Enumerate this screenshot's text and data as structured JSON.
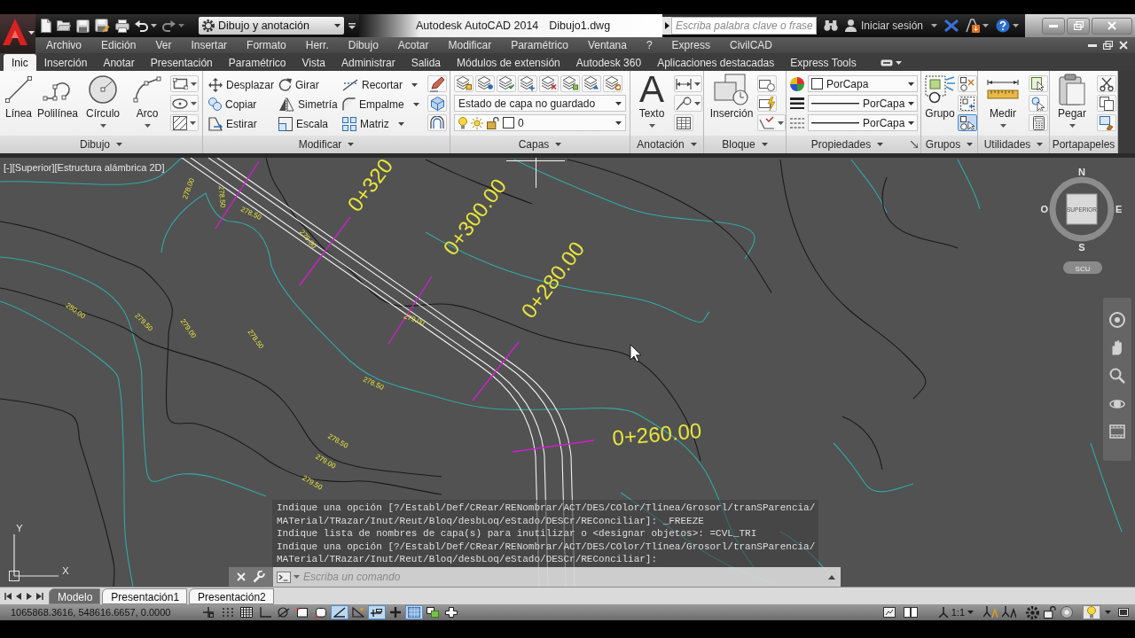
{
  "title_bar": {
    "workspace": "Dibujo y anotación",
    "app_title": "Autodesk AutoCAD 2014",
    "file_name": "Dibujo1.dwg",
    "search": {
      "placeholder": "Escriba palabra clave o frase"
    },
    "sign_in": "Iniciar sesión"
  },
  "menu_bar": [
    "Archivo",
    "Edición",
    "Ver",
    "Insertar",
    "Formato",
    "Herr.",
    "Dibujo",
    "Acotar",
    "Modificar",
    "Paramétrico",
    "Ventana",
    "?",
    "Express",
    "CivilCAD"
  ],
  "ribbon_tabs": [
    {
      "label": "Inic",
      "selected": true
    },
    {
      "label": "Inserción",
      "selected": false
    },
    {
      "label": "Anotar",
      "selected": false
    },
    {
      "label": "Presentación",
      "selected": false
    },
    {
      "label": "Paramétrico",
      "selected": false
    },
    {
      "label": "Vista",
      "selected": false
    },
    {
      "label": "Administrar",
      "selected": false
    },
    {
      "label": "Salida",
      "selected": false
    },
    {
      "label": "Módulos de extensión",
      "selected": false
    },
    {
      "label": "Autodesk 360",
      "selected": false
    },
    {
      "label": "Aplicaciones destacadas",
      "selected": false
    },
    {
      "label": "Express Tools",
      "selected": false
    }
  ],
  "ribbon_panels": [
    {
      "kind": "draw",
      "title": "Dibujo",
      "menu": true,
      "buttons": [
        {
          "label": "Línea",
          "menu": false
        },
        {
          "label": "Polilínea",
          "menu": false
        },
        {
          "label": "Círculo",
          "menu": true
        },
        {
          "label": "Arco",
          "menu": true
        }
      ]
    },
    {
      "kind": "modify",
      "title": "Modificar",
      "menu": true,
      "buttons": [
        {
          "label": "Desplazar",
          "menu": false
        },
        {
          "label": "Girar",
          "menu": false
        },
        {
          "label": "Recortar",
          "menu": true
        },
        {
          "label": "Copiar",
          "menu": false
        },
        {
          "label": "Simetría",
          "menu": false
        },
        {
          "label": "Empalme",
          "menu": true
        },
        {
          "label": "Estirar",
          "menu": false
        },
        {
          "label": "Escala",
          "menu": false
        },
        {
          "label": "Matriz",
          "menu": true
        }
      ]
    },
    {
      "kind": "layers",
      "title": "Capas",
      "menu": true,
      "layer_state": "Estado de capa no guardado",
      "current_layer": "0"
    },
    {
      "kind": "annotation",
      "title": "Anotación",
      "menu": true,
      "glyph": "A",
      "buttons": [
        {
          "label": "Texto",
          "menu": true
        }
      ]
    },
    {
      "kind": "block",
      "title": "Bloque",
      "menu": true,
      "buttons": [
        {
          "label": "Inserción",
          "menu": false
        }
      ]
    },
    {
      "kind": "properties",
      "title": "Propiedades",
      "menu": true,
      "values": [
        "PorCapa",
        "PorCapa",
        "PorCapa"
      ]
    },
    {
      "kind": "groups",
      "title": "Grupos",
      "menu": true,
      "buttons": [
        {
          "label": "Grupo",
          "menu": false
        }
      ],
      "small_buttons": [
        {
          "on": false
        },
        {
          "on": false
        },
        {
          "on": true
        }
      ]
    },
    {
      "kind": "utilities",
      "title": "Utilidades",
      "menu": true,
      "buttons": [
        {
          "label": "Medir",
          "menu": true
        }
      ]
    },
    {
      "kind": "clipboard",
      "title": "Portapapeles",
      "menu": false,
      "buttons": [
        {
          "label": "Pegar",
          "menu": true
        }
      ]
    }
  ],
  "viewport": {
    "controls": [
      "[-]",
      "[Superior]",
      "[Estructura alámbrica 2D]"
    ],
    "station_labels": [
      "0+320",
      "0+300.00",
      "0+280.00",
      "0+260.00"
    ],
    "contour_labels": [
      "278.00",
      "278.50",
      "278.50",
      "279.00",
      "280.00",
      "279.50",
      "279.00",
      "278.50",
      "279.00",
      "278.50",
      "278.50",
      "279.00",
      "279.50"
    ],
    "viewcube": {
      "face": "SUPERIOR",
      "north": "N",
      "south": "S",
      "east": "E",
      "west": "O",
      "ucs": "SCU"
    },
    "ucs_icon": {
      "x": "X",
      "y": "Y"
    }
  },
  "command_line": {
    "history": [
      "Indique una opción [?/Establ/Def/CRear/RENombrar/ACT/DES/COlor/Tlínea/Grosorl/tranSParencia/",
      "MATerial/TRazar/Inut/Reut/Bloq/desbLoq/eStado/DESCr/REConciliar]: _FREEZE",
      "Indique lista de nombres de capa(s) para inutilizar o <designar objetos>: =CVL_TRI",
      "Indique una opción [?/Establ/Def/CRear/RENombrar/ACT/DES/COlor/Tlínea/Grosorl/tranSParencia/",
      "MATerial/TRazar/Inut/Reut/Bloq/desbLoq/eStado/DESCr/REConciliar]:"
    ],
    "placeholder": "Escriba un comando"
  },
  "layout_tabs": [
    {
      "label": "Modelo",
      "selected": true
    },
    {
      "label": "Presentación1",
      "selected": false
    },
    {
      "label": "Presentación2",
      "selected": false
    }
  ],
  "status_bar": {
    "coordinates": "1065868.3616, 548616.6657, 0.0000",
    "toggles": [
      {
        "on": false
      },
      {
        "on": false
      },
      {
        "on": false
      },
      {
        "on": false
      },
      {
        "on": false
      },
      {
        "on": false
      },
      {
        "on": false
      },
      {
        "on": true
      },
      {
        "on": false
      },
      {
        "on": true
      },
      {
        "on": false
      },
      {
        "on": true
      },
      {
        "on": false
      },
      {
        "on": false
      }
    ],
    "annotation_scale": "1:1"
  }
}
